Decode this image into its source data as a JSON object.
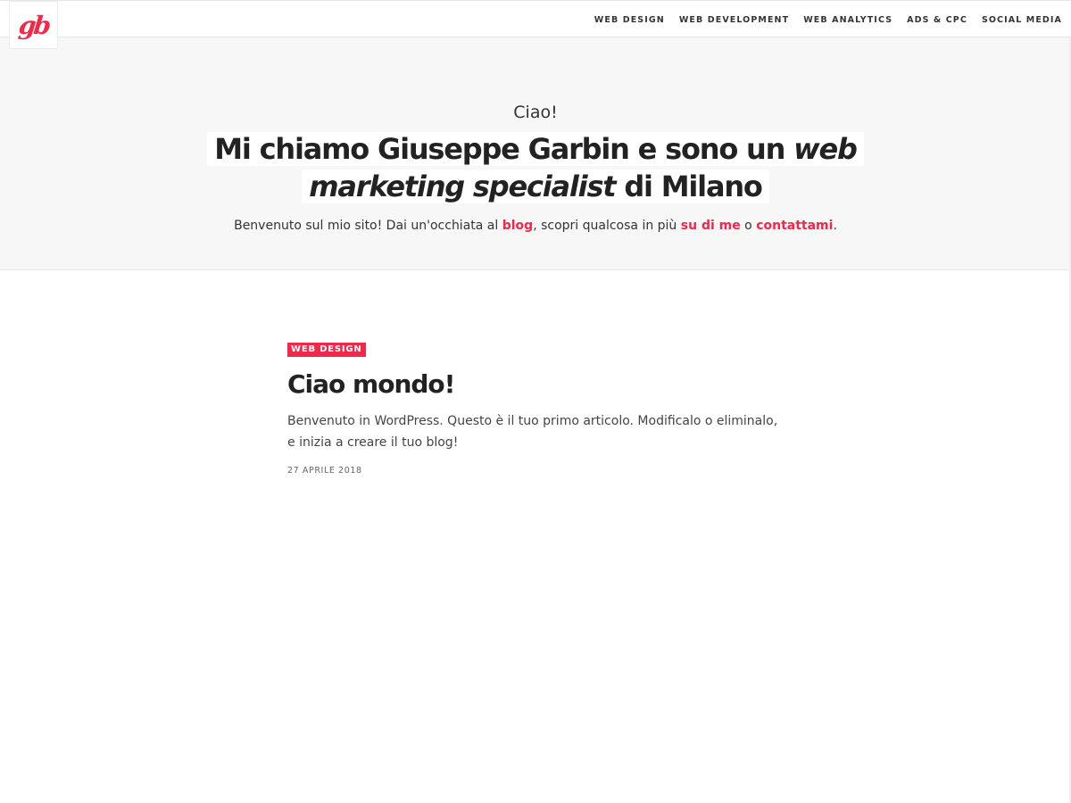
{
  "colors": {
    "accent": "#f0284a",
    "hero_bg": "#f7f7f7",
    "text": "#222222"
  },
  "header": {
    "logo_text": "gb",
    "nav": [
      {
        "label": "WEB DESIGN"
      },
      {
        "label": "WEB DEVELOPMENT"
      },
      {
        "label": "WEB ANALYTICS"
      },
      {
        "label": "ADS & CPC"
      },
      {
        "label": "SOCIAL MEDIA"
      }
    ]
  },
  "hero": {
    "greeting": "Ciao!",
    "title_part1": "Mi chiamo Giuseppe Garbin e sono un ",
    "title_emphasis": "web marketing specialist",
    "title_part2": " di Milano",
    "subtitle_part1": "Benvenuto sul mio sito! Dai un'occhiata al ",
    "link_blog": "blog",
    "subtitle_part2": ", scopri qualcosa in più ",
    "link_about": "su di me",
    "subtitle_part3": " o ",
    "link_contact": "contattami",
    "subtitle_part4": "."
  },
  "post": {
    "category": "WEB DESIGN",
    "title": "Ciao mondo!",
    "excerpt": "Benvenuto in WordPress. Questo è il tuo primo articolo. Modificalo o eliminalo, e inizia a creare il tuo blog!",
    "date": "27 APRILE 2018"
  }
}
